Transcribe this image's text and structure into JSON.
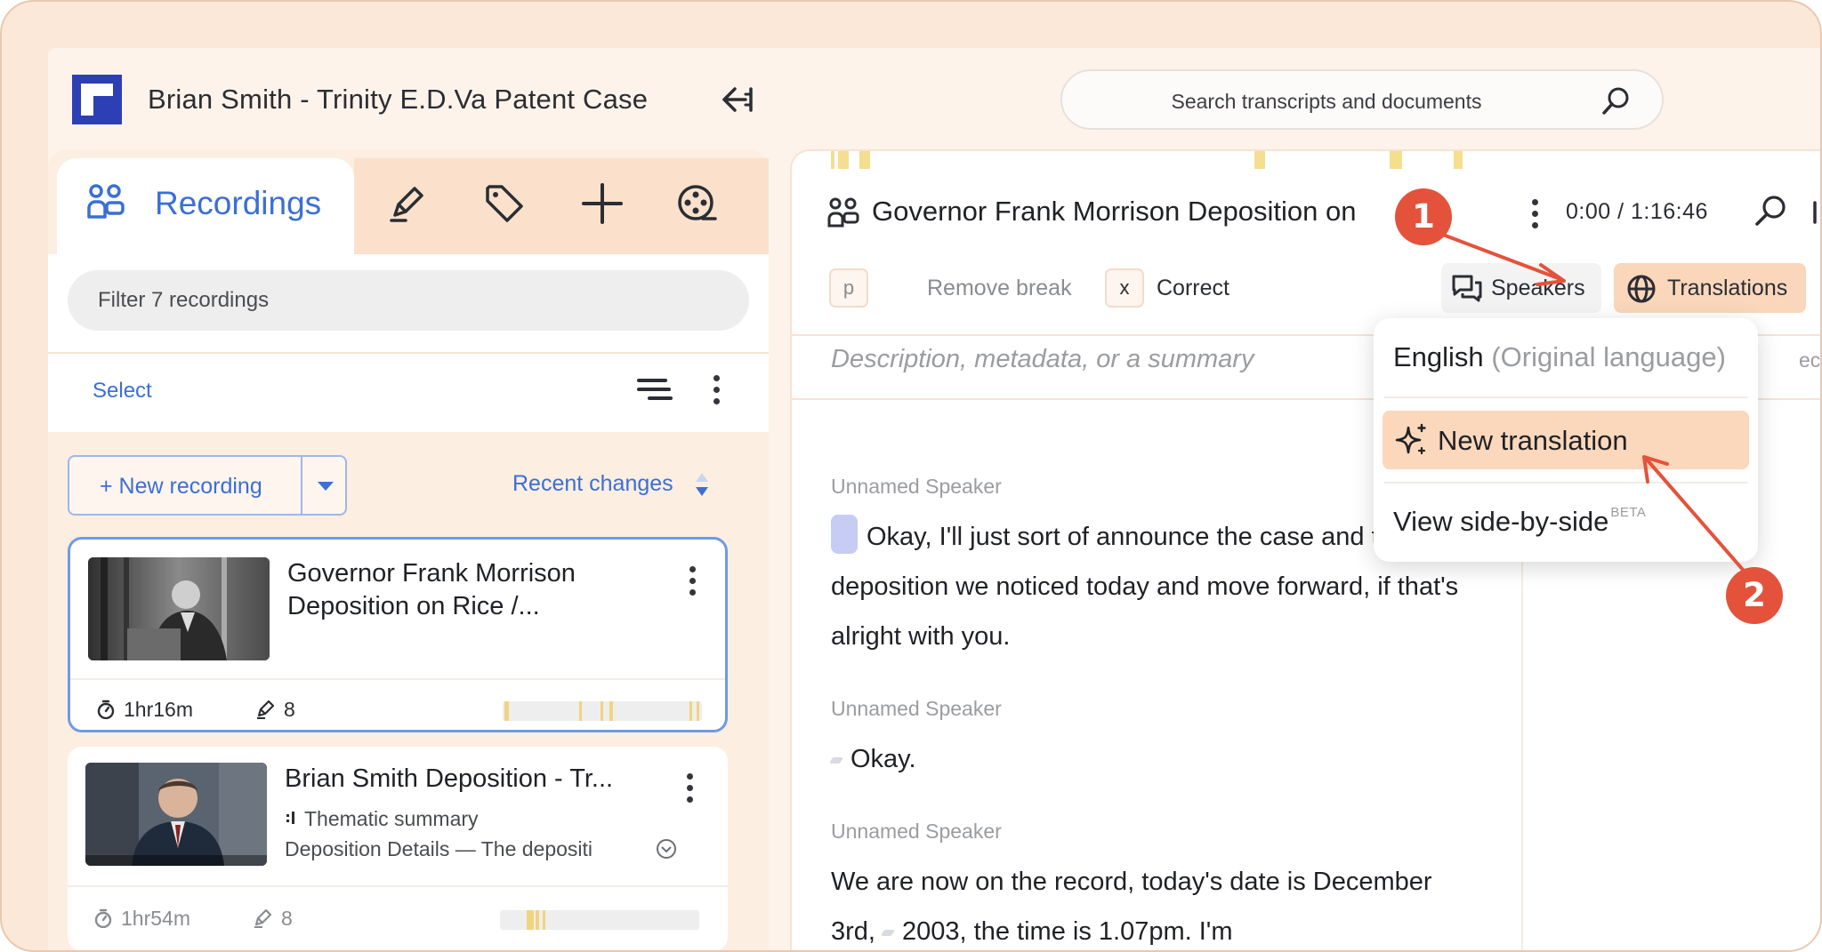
{
  "header": {
    "case_title": "Brian Smith - Trinity E.D.Va Patent Case",
    "search_placeholder": "Search transcripts and documents"
  },
  "left": {
    "tab_recordings": "Recordings",
    "filter_placeholder": "Filter 7 recordings",
    "select_label": "Select",
    "new_recording": "+ New recording",
    "sort_label": "Recent changes",
    "recordings": [
      {
        "title": "Governor Frank Morrison Deposition on Rice /...",
        "duration": "1hr16m",
        "highlights": "8",
        "selected": true
      },
      {
        "title": "Brian Smith Deposition - Tr...",
        "summary_type": "Thematic summary",
        "summary_preview": "Deposition Details — The depositi",
        "duration": "1hr54m",
        "highlights": "8",
        "selected": false
      }
    ]
  },
  "right": {
    "recording_title": "Governor Frank Morrison Deposition on",
    "time": "0:00 / 1:16:46",
    "toolbar": {
      "remove_break_key": "p",
      "remove_break_label": "Remove break",
      "correct_key": "x",
      "correct_label": "Correct",
      "speakers_label": "Speakers",
      "translations_label": "Translations"
    },
    "description_placeholder": "Description, metadata, or a summary",
    "description_overflow": "ecordi",
    "transcript": [
      {
        "speaker": "Unnamed Speaker",
        "text": "Okay, I'll just sort of announce the case and the deposition we noticed today and move forward, if that's alright with you."
      },
      {
        "speaker": "Unnamed Speaker",
        "text": "Okay."
      },
      {
        "speaker": "Unnamed Speaker",
        "text_before": "We are now on the record, today's date is December 3rd,",
        "text_after": "2003, the time is 1.07pm. I'm"
      }
    ]
  },
  "dropdown": {
    "language": "English",
    "language_note": "(Original language)",
    "new_translation": "New translation",
    "side_by_side": "View side-by-side",
    "side_by_side_badge": "BETA"
  },
  "annotations": {
    "step1": "1",
    "step2": "2",
    "color": "#e4523b"
  },
  "colors": {
    "accent_blue": "#3b6fd4",
    "frame_peach": "#fce8d8",
    "active_peach": "#fad7bb",
    "highlight_yellow": "#f0d480"
  },
  "icons": {
    "logo": "app-logo",
    "collapse": "collapse-sidebar-icon",
    "search": "search-icon",
    "recordings": "people-icon",
    "highlighter": "highlighter-icon",
    "tag": "tag-icon",
    "crosshair": "plus-icon",
    "reel": "film-reel-icon"
  }
}
